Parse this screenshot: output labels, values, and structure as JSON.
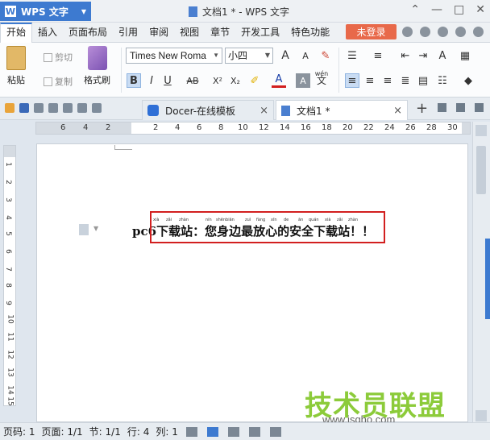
{
  "app": {
    "name": "WPS 文字",
    "window_title": "文档1 * - WPS 文字"
  },
  "menu": {
    "items": [
      "开始",
      "插入",
      "页面布局",
      "引用",
      "审阅",
      "视图",
      "章节",
      "开发工具",
      "特色功能"
    ],
    "login": "未登录"
  },
  "ribbon": {
    "paste": "粘贴",
    "cut": "剪切",
    "copy": "复制",
    "format_painter": "格式刷",
    "font_name": "Times New Roma",
    "font_size": "小四",
    "bold": "B",
    "italic": "I",
    "underline": "U",
    "strike": "AB",
    "superscript": "X²",
    "subscript": "X₂",
    "font_color": "A",
    "grow": "A",
    "shrink": "A",
    "phonetic": "wén",
    "phonetic_char": "文"
  },
  "tabs": {
    "docer": "Docer-在线模板",
    "doc1": "文档1 *",
    "close": "×",
    "new": "+"
  },
  "ruler": {
    "h_ticks": [
      "6",
      "4",
      "2",
      "2",
      "4",
      "6",
      "8",
      "10",
      "12",
      "14",
      "16",
      "18",
      "20",
      "22",
      "24",
      "26",
      "28",
      "30",
      "32",
      "34",
      "36",
      "38"
    ],
    "v_ticks": [
      "1",
      "1",
      "2",
      "3",
      "4",
      "5",
      "6",
      "7",
      "8",
      "9",
      "10",
      "11",
      "12",
      "13",
      "14",
      "15"
    ]
  },
  "document": {
    "text_prefix": "pc6",
    "text_main": "下载站：您身边最放心的安全下载站！！",
    "pinyin": [
      "xià",
      "zǎi",
      "zhàn",
      "nín",
      "shēnbiān",
      "zuì",
      "fàng",
      "xīn",
      "de",
      "ān",
      "quán",
      "xià",
      "zǎi",
      "zhàn"
    ]
  },
  "statusbar": {
    "page_num": "页码: 1",
    "pages": "页面: 1/1",
    "section": "节: 1/1",
    "row": "行: 4",
    "col": "列: 1"
  },
  "watermark": {
    "title": "技术员联盟",
    "url": "www.jsgho.com"
  },
  "colors": {
    "accent": "#3d7ad0",
    "login": "#e8694a",
    "highlight": "#d21f1f",
    "watermark": "#8ccb3a"
  }
}
